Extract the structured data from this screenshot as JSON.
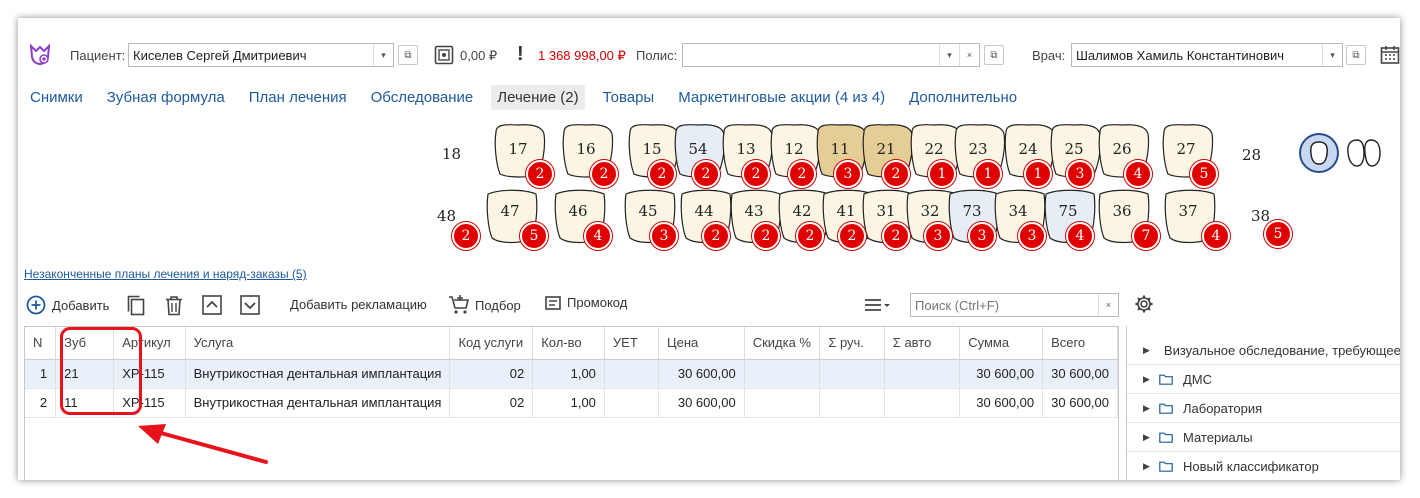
{
  "header": {
    "patient_label": "Пациент:",
    "patient_value": "Киселев Сергей Дмитриевич",
    "balance": "0,00 ₽",
    "debt": "1 368 998,00 ₽",
    "policy_label": "Полис:",
    "policy_value": "",
    "doctor_label": "Врач:",
    "doctor_value": "Шалимов Хамиль Константинович"
  },
  "tabs": [
    {
      "label": "Снимки"
    },
    {
      "label": "Зубная формула"
    },
    {
      "label": "План лечения"
    },
    {
      "label": "Обследование"
    },
    {
      "label": "Лечение (2)",
      "active": true
    },
    {
      "label": "Товары"
    },
    {
      "label": "Маркетинговые акции (4 из 4)"
    },
    {
      "label": "Дополнительно"
    }
  ],
  "dental_chart": {
    "quadrant_labels": {
      "upper_right": "18",
      "upper_left": "28",
      "lower_right": "48",
      "lower_left": "38"
    },
    "upper_row": [
      {
        "n": "17",
        "badge": "2",
        "state": "normal"
      },
      {
        "n": "16",
        "badge": "2",
        "state": "normal"
      },
      {
        "n": "15",
        "badge": "2",
        "state": "normal"
      },
      {
        "n": "54",
        "badge": "2",
        "state": "milk"
      },
      {
        "n": "13",
        "badge": "2",
        "state": "normal"
      },
      {
        "n": "12",
        "badge": "2",
        "state": "normal"
      },
      {
        "n": "11",
        "badge": "3",
        "state": "selected"
      },
      {
        "n": "21",
        "badge": "2",
        "state": "selected"
      },
      {
        "n": "22",
        "badge": "1",
        "state": "normal"
      },
      {
        "n": "23",
        "badge": "1",
        "state": "normal"
      },
      {
        "n": "24",
        "badge": "1",
        "state": "normal"
      },
      {
        "n": "25",
        "badge": "3",
        "state": "normal"
      },
      {
        "n": "26",
        "badge": "4",
        "state": "normal"
      },
      {
        "n": "27",
        "badge": "5",
        "state": "normal"
      }
    ],
    "lower_row": [
      {
        "n": "47",
        "badge": "5",
        "state": "normal"
      },
      {
        "n": "46",
        "badge": "4",
        "state": "normal"
      },
      {
        "n": "45",
        "badge": "3",
        "state": "normal"
      },
      {
        "n": "44",
        "badge": "2",
        "state": "normal"
      },
      {
        "n": "43",
        "badge": "2",
        "state": "normal"
      },
      {
        "n": "42",
        "badge": "2",
        "state": "normal"
      },
      {
        "n": "41",
        "badge": "2",
        "state": "normal"
      },
      {
        "n": "31",
        "badge": "2",
        "state": "normal"
      },
      {
        "n": "32",
        "badge": "3",
        "state": "normal"
      },
      {
        "n": "73",
        "badge": "3",
        "state": "milk"
      },
      {
        "n": "34",
        "badge": "3",
        "state": "normal"
      },
      {
        "n": "75",
        "badge": "4",
        "state": "milk"
      },
      {
        "n": "36",
        "badge": "7",
        "state": "normal"
      },
      {
        "n": "37",
        "badge": "4",
        "state": "normal"
      }
    ],
    "lower_right_badge": "2",
    "lower_left_badge": "5"
  },
  "unfinished_link": "Незаконченные планы лечения и наряд-заказы (5)",
  "toolbar": {
    "add": "Добавить",
    "add_claim": "Добавить рекламацию",
    "selection": "Подбор",
    "promo": "Промокод",
    "search_placeholder": "Поиск (Ctrl+F)",
    "search_clear": "×"
  },
  "table": {
    "columns": [
      "N",
      "Зуб",
      "Артикул",
      "Услуга",
      "Код услуги",
      "Кол-во",
      "УЕТ",
      "Цена",
      "Скидка %",
      "Σ руч.",
      "Σ авто",
      "Сумма",
      "Всего"
    ],
    "rows": [
      {
        "n": "1",
        "tooth": "21",
        "article": "ХР-115",
        "service": "Внутрикостная дентальная имплантация",
        "code": "02",
        "qty": "1,00",
        "uet": "",
        "price": "30 600,00",
        "discount": "",
        "manual": "",
        "auto": "",
        "sum": "30 600,00",
        "total": "30 600,00"
      },
      {
        "n": "2",
        "tooth": "11",
        "article": "ХР-115",
        "service": "Внутрикостная дентальная имплантация",
        "code": "02",
        "qty": "1,00",
        "uet": "",
        "price": "30 600,00",
        "discount": "",
        "manual": "",
        "auto": "",
        "sum": "30 600,00",
        "total": "30 600,00"
      }
    ]
  },
  "classifier": [
    "Визуальное обследование, требующее",
    "ДМС",
    "Лаборатория",
    "Материалы",
    "Новый классификатор"
  ],
  "colors": {
    "link": "#1e5a9e",
    "debt": "#d40000",
    "badge": "#e10000",
    "tooth_normal": "#fbf6e4",
    "tooth_selected": "#e5cd96",
    "tooth_milk": "#e6edf5",
    "annotation": "#e8121b"
  }
}
